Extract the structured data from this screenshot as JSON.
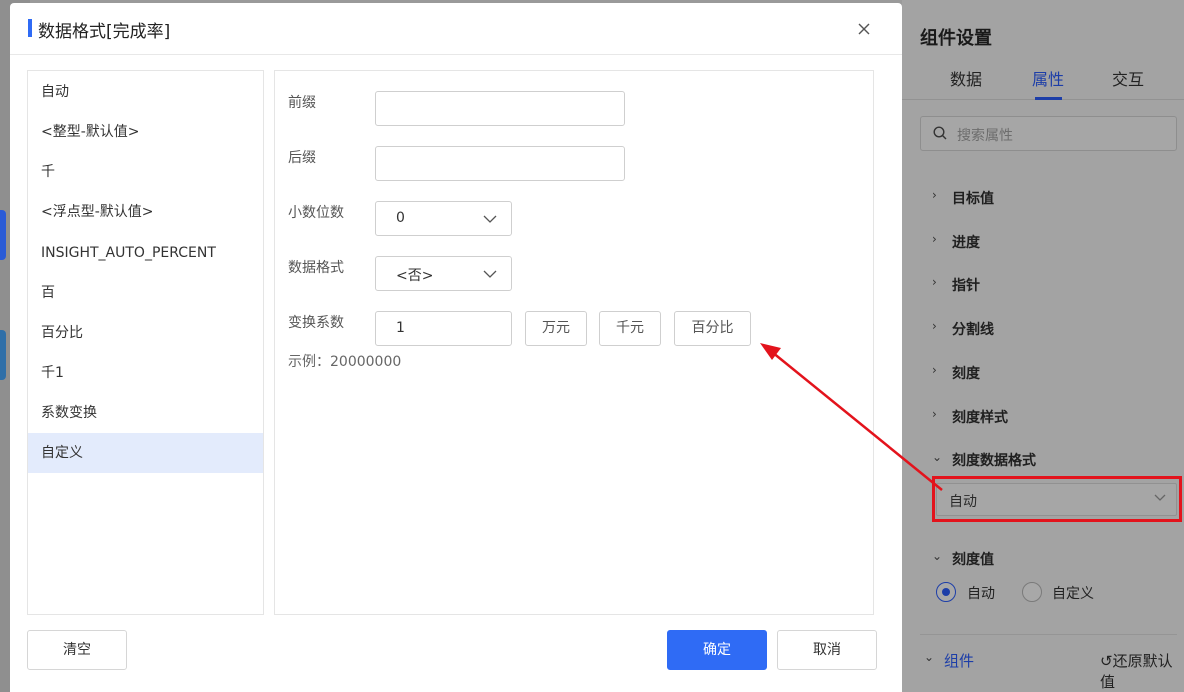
{
  "dialog": {
    "title": "数据格式[完成率]",
    "format_list": [
      "自动",
      "<整型-默认值>",
      "千",
      "<浮点型-默认值>",
      "INSIGHT_AUTO_PERCENT",
      "百",
      "百分比",
      "千1",
      "系数变换",
      "自定义"
    ],
    "selected_format": "自定义",
    "form": {
      "prefix_label": "前缀",
      "prefix_value": "",
      "suffix_label": "后缀",
      "suffix_value": "",
      "decimals_label": "小数位数",
      "decimals_value": "0",
      "data_format_label": "数据格式",
      "data_format_value": "<否>",
      "coef_label": "变换系数",
      "coef_value": "1",
      "coef_buttons": [
        "万元",
        "千元",
        "百分比"
      ],
      "example": "示例：20000000"
    },
    "buttons": {
      "clear": "清空",
      "ok": "确定",
      "cancel": "取消"
    }
  },
  "right_panel": {
    "title": "组件设置",
    "tabs": [
      "数据",
      "属性",
      "交互"
    ],
    "active_tab": "属性",
    "search_placeholder": "搜索属性",
    "sections": [
      "目标值",
      "进度",
      "指针",
      "分割线",
      "刻度",
      "刻度样式",
      "刻度数据格式"
    ],
    "scale_format_value": "自动",
    "scale_value_section": "刻度值",
    "radio_options": [
      "自动",
      "自定义"
    ],
    "radio_selected": "自动",
    "footer_component": "组件",
    "footer_reset": "还原默认值"
  },
  "colors": {
    "primary": "#2f6bf5",
    "highlight": "#e3131c",
    "selected_bg": "#e3ebfc"
  }
}
